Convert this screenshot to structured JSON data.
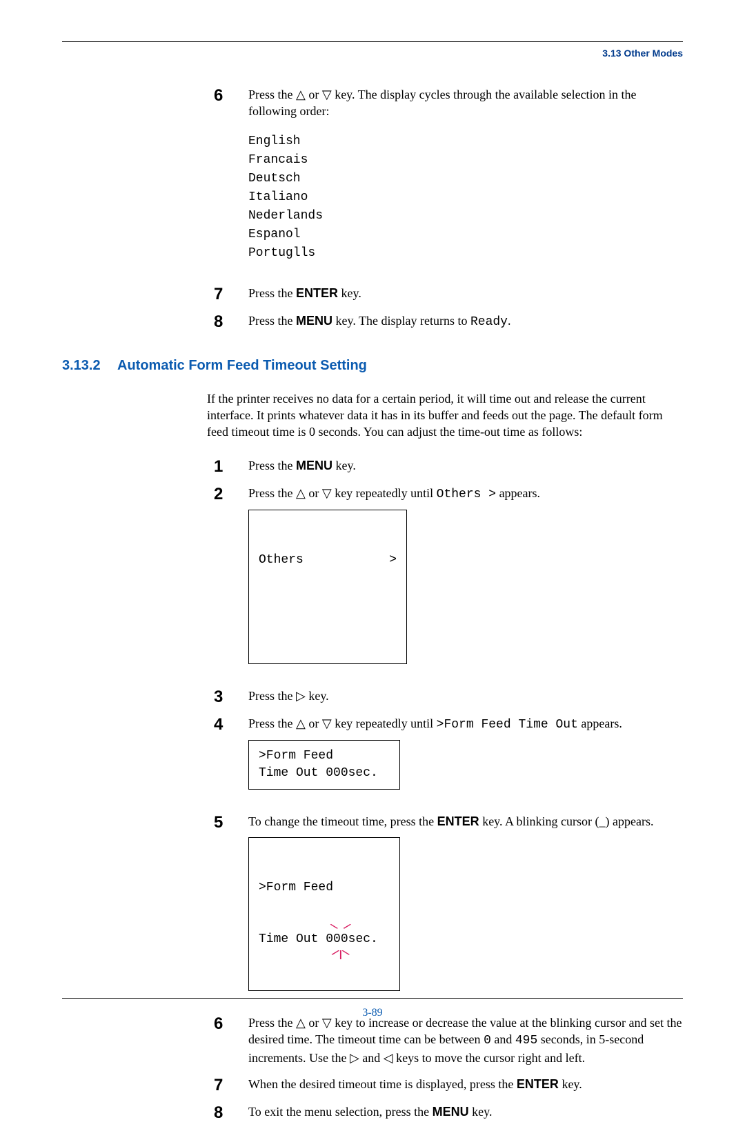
{
  "header": {
    "section_ref": "3.13 Other Modes"
  },
  "block1": {
    "step6": {
      "num": "6",
      "text_a": "Press the ",
      "tri_up": "△",
      "text_b": " or ",
      "tri_down": "▽",
      "text_c": " key. The display cycles through the available selection in the following order:"
    },
    "languages": [
      "English",
      "Francais",
      "Deutsch",
      "Italiano",
      "Nederlands",
      "Espanol",
      "Portuglls"
    ],
    "step7": {
      "num": "7",
      "text_a": "Press the ",
      "key": "ENTER",
      "text_b": " key."
    },
    "step8": {
      "num": "8",
      "text_a": "Press the ",
      "key": "MENU",
      "text_b": " key. The display returns to ",
      "mono": "Ready",
      "text_c": "."
    }
  },
  "section": {
    "num": "3.13.2",
    "title": "Automatic Form Feed Timeout Setting"
  },
  "intro": "If the printer receives no data for a certain period, it will time out and release the current interface. It prints whatever data it has in its buffer and feeds out the page. The default form feed timeout time is 0 seconds. You can adjust the time-out time as follows:",
  "steps2": {
    "s1": {
      "num": "1",
      "text_a": "Press the ",
      "key": "MENU",
      "text_b": " key."
    },
    "s2": {
      "num": "2",
      "text_a": "Press the ",
      "tri_up": "△",
      "text_b": " or ",
      "tri_down": "▽",
      "text_c": " key repeatedly until ",
      "mono": "Others >",
      "text_d": " appears.",
      "lcd_left": "Others",
      "lcd_right": ">"
    },
    "s3": {
      "num": "3",
      "text_a": "Press the ",
      "tri_right": "▷",
      "text_b": " key."
    },
    "s4": {
      "num": "4",
      "text_a": "Press the ",
      "tri_up": "△",
      "text_b": " or ",
      "tri_down": "▽",
      "text_c": " key repeatedly until ",
      "mono": ">Form Feed Time Out",
      "text_d": " appears.",
      "lcd": ">Form Feed\nTime Out 000sec."
    },
    "s5": {
      "num": "5",
      "text_a": "To change the timeout time, press the ",
      "key": "ENTER",
      "text_b": " key. A blinking cursor (_) appears.",
      "lcd_line1": ">Form Feed",
      "lcd_line2a": "Time Out 0",
      "lcd_cursor": "00",
      "lcd_line2b": "sec."
    },
    "s6": {
      "num": "6",
      "text_a": "Press the ",
      "tri_up": "△",
      "text_b": " or ",
      "tri_down": "▽",
      "text_c": " key to increase or decrease the value at the blinking cursor and set the desired time. The timeout time can be between ",
      "mono1": "0",
      "text_d": " and ",
      "mono2": "495",
      "text_e": " seconds, in 5-second increments. Use the ",
      "tri_right": "▷",
      "text_f": " and ",
      "tri_left": "◁",
      "text_g": " keys to move the cursor right and left."
    },
    "s7": {
      "num": "7",
      "text_a": "When the desired timeout time is displayed, press the ",
      "key": "ENTER",
      "text_b": " key."
    },
    "s8": {
      "num": "8",
      "text_a": " To exit the menu selection, press the ",
      "key": "MENU",
      "text_b": " key."
    }
  },
  "footer": {
    "page": "3-89"
  }
}
